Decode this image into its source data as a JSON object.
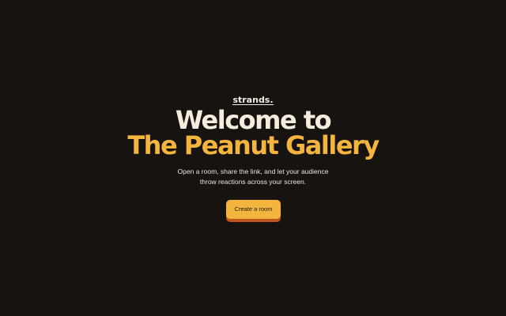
{
  "brand": {
    "logo": "strands."
  },
  "hero": {
    "title_line1": "Welcome to",
    "title_line2": "The Peanut Gallery",
    "subtitle_line1": "Open a room, share the link, and let your audience",
    "subtitle_line2": "throw reactions across your screen."
  },
  "actions": {
    "create_room": "Create a room"
  },
  "colors": {
    "background": "#161310",
    "cream": "#f5ecde",
    "accent": "#f4b53f",
    "button_shadow": "#c4541d"
  }
}
